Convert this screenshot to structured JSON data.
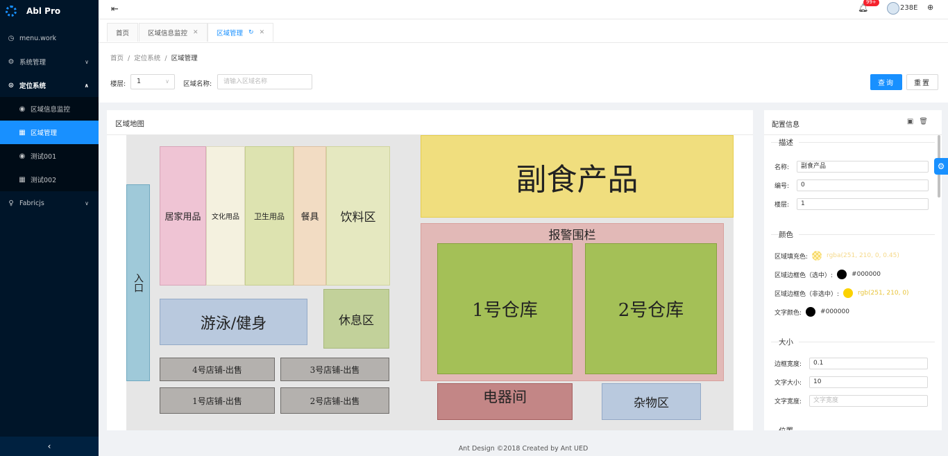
{
  "app": {
    "title": "Abl Pro"
  },
  "sidebar": {
    "items": [
      {
        "label": "menu.work",
        "icon": "clock-icon"
      },
      {
        "label": "系统管理",
        "icon": "gear-icon"
      },
      {
        "label": "定位系统",
        "icon": "location-icon"
      },
      {
        "label": "区域信息监控",
        "icon": "eye-icon"
      },
      {
        "label": "区域管理",
        "icon": "table-icon"
      },
      {
        "label": "测试001",
        "icon": "eye-icon"
      },
      {
        "label": "测试002",
        "icon": "table-icon"
      },
      {
        "label": "Fabricjs",
        "icon": "bulb-icon"
      }
    ]
  },
  "header": {
    "badge": "99+",
    "user": "238E"
  },
  "tabs": [
    {
      "label": "首页"
    },
    {
      "label": "区域信息监控"
    },
    {
      "label": "区域管理"
    }
  ],
  "breadcrumb": {
    "home": "首页",
    "parent": "定位系统",
    "current": "区域管理"
  },
  "filters": {
    "floor_label": "楼层:",
    "floor_value": "1",
    "name_label": "区域名称:",
    "name_placeholder": "请输入区域名称",
    "query_label": "查询",
    "reset_label": "重置"
  },
  "map": {
    "title": "区域地图",
    "zones": {
      "entrance": "入口",
      "home": "居家用品",
      "culture": "文化用品",
      "hygiene": "卫生用品",
      "tableware": "餐具",
      "drinks": "饮料区",
      "swim": "游泳/健身",
      "rest": "休息区",
      "shop4": "4号店铺-出售",
      "shop3": "3号店铺-出售",
      "shop1": "1号店铺-出售",
      "shop2": "2号店铺-出售",
      "food": "副食产品",
      "fence": "报警围栏",
      "wh1": "1号仓库",
      "wh2": "2号仓库",
      "electric": "电器间",
      "misc": "杂物区"
    }
  },
  "config": {
    "title": "配置信息",
    "sections": {
      "desc": "描述",
      "color": "颜色",
      "size": "大小",
      "pos": "位置"
    },
    "name_label": "名称:",
    "name_value": "副食产品",
    "code_label": "编号:",
    "code_value": "0",
    "floor_label": "楼层:",
    "floor_value": "1",
    "fill_label": "区域填充色:",
    "fill_value": "rgba(251, 210, 0, 0.45)",
    "border_sel_label": "区域边框色（选中）:",
    "border_sel_value": "#000000",
    "border_unsel_label": "区域边框色（非选中）:",
    "border_unsel_value": "rgb(251, 210, 0)",
    "text_color_label": "文字颜色:",
    "text_color_value": "#000000",
    "border_width_label": "边框宽度:",
    "border_width_value": "0.1",
    "font_size_label": "文字大小:",
    "font_size_value": "10",
    "text_width_label": "文字宽度:",
    "text_width_placeholder": "文字宽度"
  },
  "footer": {
    "text": "Ant Design ©2018 Created by Ant UED"
  },
  "colors": {
    "primary": "#1890ff",
    "sidebar": "#001529",
    "warn": "#fbd200"
  }
}
